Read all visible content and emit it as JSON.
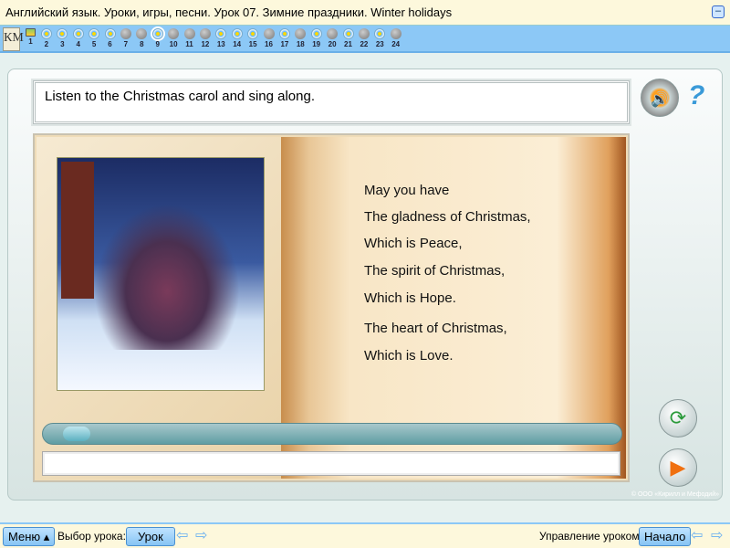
{
  "window": {
    "title": "Английский язык. Уроки, игры, песни. Урок 07. Зимние праздники. Winter holidays",
    "minimize_icon": "minimize-icon"
  },
  "nav": {
    "logo": "КМ",
    "items": [
      {
        "n": "1",
        "type": "img"
      },
      {
        "n": "2",
        "type": "flower"
      },
      {
        "n": "3",
        "type": "flower"
      },
      {
        "n": "4",
        "type": "flower"
      },
      {
        "n": "5",
        "type": "flower"
      },
      {
        "n": "6",
        "type": "flower"
      },
      {
        "n": "7",
        "type": "gray"
      },
      {
        "n": "8",
        "type": "gray"
      },
      {
        "n": "9",
        "type": "flower",
        "selected": true
      },
      {
        "n": "10",
        "type": "gray"
      },
      {
        "n": "11",
        "type": "gray"
      },
      {
        "n": "12",
        "type": "gray"
      },
      {
        "n": "13",
        "type": "flower"
      },
      {
        "n": "14",
        "type": "flower"
      },
      {
        "n": "15",
        "type": "flower"
      },
      {
        "n": "16",
        "type": "gray"
      },
      {
        "n": "17",
        "type": "flower"
      },
      {
        "n": "18",
        "type": "gray"
      },
      {
        "n": "19",
        "type": "flower"
      },
      {
        "n": "20",
        "type": "gray"
      },
      {
        "n": "21",
        "type": "flower"
      },
      {
        "n": "22",
        "type": "gray"
      },
      {
        "n": "23",
        "type": "flower"
      },
      {
        "n": "24",
        "type": "gray"
      }
    ]
  },
  "task": {
    "instruction": "Listen to the Christmas carol and sing along."
  },
  "song": {
    "lines": [
      "May you have",
      "The gladness of Christmas,",
      "Which is Peace,",
      "The spirit of Christmas,",
      "Which is Hope.",
      "The heart of Christmas,",
      "Which is Love."
    ]
  },
  "player": {
    "progress": 0.03,
    "answer": ""
  },
  "icons": {
    "speaker": "🔊",
    "help": "?",
    "refresh": "⟳",
    "play": "▶"
  },
  "copyright": "© ООО «Кирилл и Мефодий»",
  "bottom": {
    "menu": "Меню ▴",
    "lesson_choice_label": "Выбор урока:",
    "lesson_button": "Урок",
    "control_label": "Управление уроком:",
    "start_button": "Начало",
    "prev": "⇦",
    "next": "⇨"
  }
}
